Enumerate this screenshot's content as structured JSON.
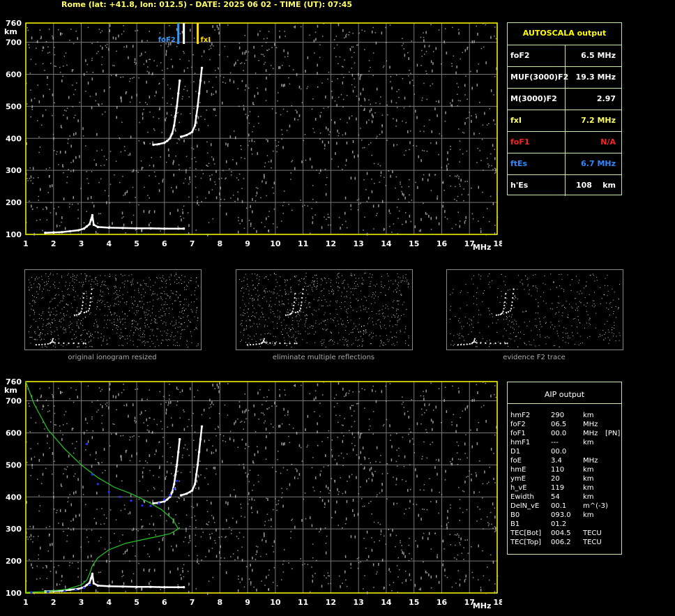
{
  "header": {
    "title": "Rome (lat: +41.8, lon: 012.5) - DATE: 2025 06 02 - TIME (UT): 07:45"
  },
  "colors": {
    "axis": "#ffff00",
    "grid": "#777777",
    "panel_border": "#c8e8b0",
    "trace": "#ffffff",
    "foF2_marker": "#3399ff",
    "fxI_marker": "#ffdd00",
    "profile": "#22cc22",
    "aip_points": "#2233ff",
    "foF1_text": "#ff2222",
    "ftEs_text": "#3388ff",
    "fxI_text": "#ffff66"
  },
  "top_chart": {
    "y_unit": "km",
    "x_unit": "MHz",
    "y_ticks": [
      "100",
      "200",
      "300",
      "400",
      "500",
      "600",
      "700",
      "760"
    ],
    "x_ticks": [
      "1",
      "2",
      "3",
      "4",
      "5",
      "6",
      "7",
      "8",
      "9",
      "10",
      "11",
      "12",
      "13",
      "14",
      "15",
      "16",
      "17",
      "18"
    ],
    "marker_foF2_label": "foF2",
    "marker_fxI_label": "fxI"
  },
  "autoscala": {
    "title": "AUTOSCALA output",
    "rows": [
      {
        "label": "foF2",
        "value": "6.5 MHz",
        "color": "#ffffff"
      },
      {
        "label": "MUF(3000)F2",
        "value": "19.3 MHz",
        "color": "#ffffff"
      },
      {
        "label": "M(3000)F2",
        "value": "2.97",
        "color": "#ffffff"
      },
      {
        "label": "fxI",
        "value": "7.2 MHz",
        "color": "#ffff66"
      },
      {
        "label": "foF1",
        "value": "N/A",
        "color": "#ff2222"
      },
      {
        "label": "ftEs",
        "value": "6.7 MHz",
        "color": "#3388ff"
      },
      {
        "label": "h'Es",
        "value": "108    km",
        "color": "#ffffff"
      }
    ]
  },
  "thumbnails": [
    {
      "caption": "original ionogram resized"
    },
    {
      "caption": "eliminate multiple reflections"
    },
    {
      "caption": "evidence F2 trace"
    }
  ],
  "aip": {
    "title": "AIP output",
    "rows": [
      {
        "name": "hmF2",
        "value": "290",
        "unit": "km",
        "extra": ""
      },
      {
        "name": "foF2",
        "value": "06.5",
        "unit": "MHz",
        "extra": ""
      },
      {
        "name": "foF1",
        "value": "00.0",
        "unit": "MHz",
        "extra": "[PN]"
      },
      {
        "name": "hmF1",
        "value": "---",
        "unit": "km",
        "extra": ""
      },
      {
        "name": "D1",
        "value": "00.0",
        "unit": "",
        "extra": ""
      },
      {
        "name": "foE",
        "value": "3.4",
        "unit": "MHz",
        "extra": ""
      },
      {
        "name": "hmE",
        "value": "110",
        "unit": "km",
        "extra": ""
      },
      {
        "name": "ymE",
        "value": "20",
        "unit": "km",
        "extra": ""
      },
      {
        "name": "h_vE",
        "value": "119",
        "unit": "km",
        "extra": ""
      },
      {
        "name": "Ewidth",
        "value": "54",
        "unit": "km",
        "extra": ""
      },
      {
        "name": "DelN_vE",
        "value": "00.1",
        "unit": "m^(-3)",
        "extra": ""
      },
      {
        "name": "B0",
        "value": "093.0",
        "unit": "km",
        "extra": ""
      },
      {
        "name": "B1",
        "value": "01.2",
        "unit": "",
        "extra": ""
      },
      {
        "name": "TEC[Bot]",
        "value": "004.5",
        "unit": "TECU",
        "extra": ""
      },
      {
        "name": "TEC[Top]",
        "value": "006.2",
        "unit": "TECU",
        "extra": ""
      }
    ]
  },
  "chart_data": {
    "type": "scatter",
    "xlim": [
      1,
      18
    ],
    "ylim": [
      100,
      760
    ],
    "xlabel": "MHz",
    "ylabel": "km",
    "grid": true,
    "markers": {
      "foF2": 6.5,
      "ftEs": 6.7,
      "fxI": 7.2
    },
    "series": [
      {
        "name": "E trace",
        "points": [
          [
            1.7,
            105
          ],
          [
            2.0,
            106
          ],
          [
            2.3,
            107
          ],
          [
            2.6,
            110
          ],
          [
            2.9,
            113
          ],
          [
            3.1,
            118
          ],
          [
            3.2,
            125
          ],
          [
            3.3,
            132
          ],
          [
            3.35,
            145
          ],
          [
            3.4,
            160
          ],
          [
            3.45,
            130
          ],
          [
            3.6,
            123
          ],
          [
            4.0,
            121
          ],
          [
            4.5,
            120
          ],
          [
            5.0,
            119
          ],
          [
            5.5,
            119
          ],
          [
            6.0,
            118
          ],
          [
            6.5,
            118
          ],
          [
            6.7,
            118
          ]
        ]
      },
      {
        "name": "F2 ordinary trace",
        "points": [
          [
            5.6,
            380
          ],
          [
            5.8,
            382
          ],
          [
            6.0,
            386
          ],
          [
            6.1,
            392
          ],
          [
            6.2,
            400
          ],
          [
            6.28,
            415
          ],
          [
            6.35,
            440
          ],
          [
            6.4,
            470
          ],
          [
            6.45,
            500
          ],
          [
            6.5,
            540
          ],
          [
            6.55,
            580
          ]
        ]
      },
      {
        "name": "F2 extraordinary trace",
        "points": [
          [
            6.6,
            405
          ],
          [
            6.8,
            410
          ],
          [
            7.0,
            420
          ],
          [
            7.1,
            440
          ],
          [
            7.15,
            470
          ],
          [
            7.2,
            500
          ],
          [
            7.25,
            540
          ],
          [
            7.3,
            580
          ],
          [
            7.35,
            620
          ]
        ]
      },
      {
        "name": "AIP profile",
        "points": [
          [
            1.0,
            760
          ],
          [
            1.3,
            690
          ],
          [
            1.8,
            610
          ],
          [
            2.4,
            550
          ],
          [
            3.0,
            500
          ],
          [
            3.6,
            460
          ],
          [
            4.2,
            430
          ],
          [
            4.8,
            410
          ],
          [
            5.4,
            385
          ],
          [
            5.9,
            360
          ],
          [
            6.3,
            330
          ],
          [
            6.5,
            300
          ],
          [
            6.2,
            285
          ],
          [
            5.4,
            270
          ],
          [
            4.6,
            255
          ],
          [
            4.0,
            235
          ],
          [
            3.6,
            210
          ],
          [
            3.4,
            185
          ],
          [
            3.3,
            160
          ],
          [
            3.2,
            140
          ],
          [
            3.0,
            125
          ],
          [
            2.5,
            112
          ],
          [
            1.8,
            105
          ],
          [
            1.0,
            102
          ]
        ]
      },
      {
        "name": "AIP fitted points",
        "points": [
          [
            3.2,
            565
          ],
          [
            3.4,
            470
          ],
          [
            3.6,
            440
          ],
          [
            4.0,
            415
          ],
          [
            4.4,
            400
          ],
          [
            4.8,
            388
          ],
          [
            5.2,
            373
          ],
          [
            5.5,
            372
          ],
          [
            5.8,
            380
          ],
          [
            6.0,
            392
          ],
          [
            6.2,
            405
          ],
          [
            6.35,
            425
          ],
          [
            6.45,
            450
          ],
          [
            1.2,
            102
          ],
          [
            1.8,
            103
          ],
          [
            2.4,
            106
          ],
          [
            2.8,
            110
          ],
          [
            3.1,
            116
          ],
          [
            3.3,
            125
          ]
        ]
      }
    ]
  }
}
